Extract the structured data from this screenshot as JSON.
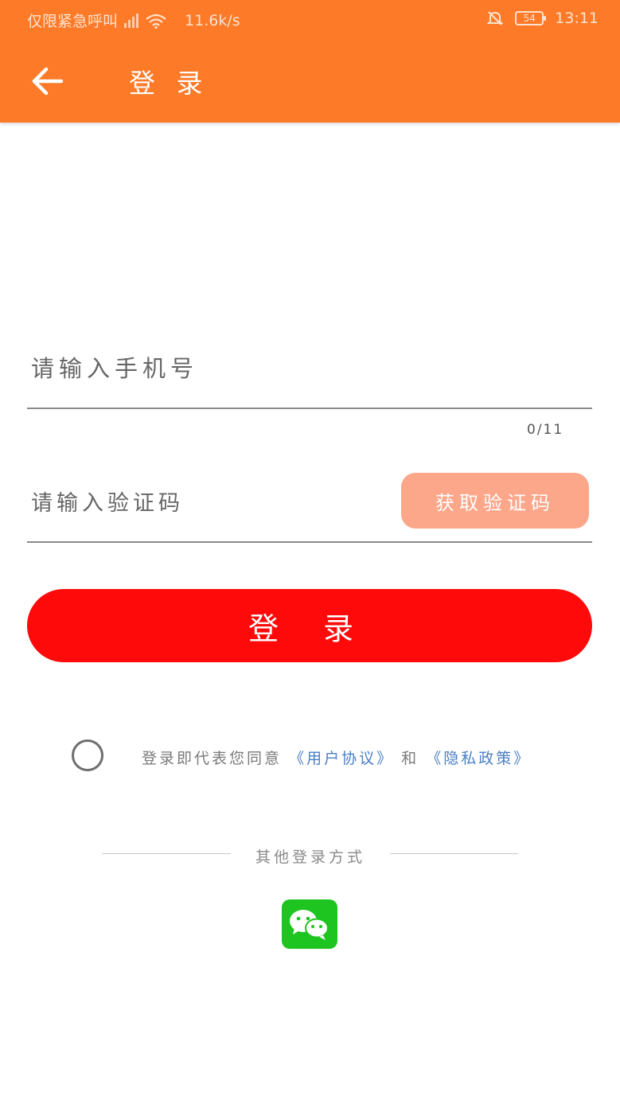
{
  "status_bar": {
    "carrier": "仅限紧急呼叫",
    "network_speed": "11.6k/s",
    "battery": "54",
    "time": "13:11",
    "icons": [
      "signal-icon",
      "wifi-icon",
      "mute-icon",
      "battery-icon"
    ]
  },
  "header": {
    "title": "登 录",
    "back_icon": "arrow-left-icon"
  },
  "phone_field": {
    "placeholder": "请输入手机号",
    "value": "",
    "counter": "0/11"
  },
  "code_field": {
    "placeholder": "请输入验证码",
    "value": "",
    "get_code_label": "获取验证码"
  },
  "login_button": {
    "label": "登 录"
  },
  "agreement": {
    "prefix": "登录即代表您同意",
    "user_agreement": "《用户协议》",
    "conjunction": "和",
    "privacy_policy": "《隐私政策》",
    "checked": false
  },
  "other_login": {
    "label": "其他登录方式",
    "providers": [
      "wechat-icon"
    ]
  },
  "colors": {
    "header_bg": "#fd7a28",
    "login_button": "#fe0a0a",
    "get_code_button": "#fca68a",
    "link": "#4a7fc4",
    "wechat": "#1ec420"
  }
}
